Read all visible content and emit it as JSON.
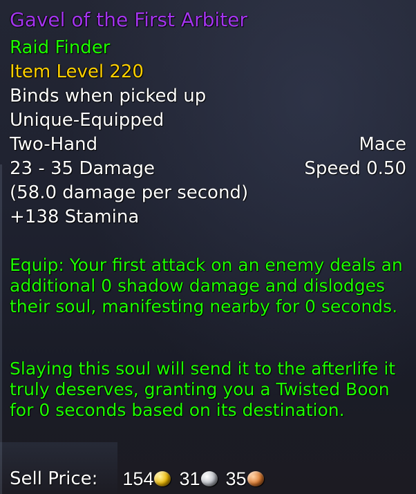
{
  "item": {
    "name": "Gavel of the First Arbiter",
    "difficulty": "Raid Finder",
    "item_level": "Item Level 220",
    "binding": "Binds when picked up",
    "unique": "Unique-Equipped",
    "slot": "Two-Hand",
    "type": "Mace",
    "damage": "23 - 35 Damage",
    "speed": "Speed 0.50",
    "dps": "(58.0 damage per second)",
    "stat": "+138 Stamina",
    "equip_effect": "Equip: Your first attack on an enemy deals an additional 0 shadow damage and dislodges their soul, manifesting nearby for 0 seconds.",
    "effect_detail": "Slaying this soul will send it to the afterlife it truly deserves, granting you a Twisted Boon for 0 seconds based on its destination."
  },
  "sell_price": {
    "label": "Sell Price:",
    "gold": "154",
    "silver": "31",
    "copper": "35"
  },
  "colors": {
    "epic": "#a335ee",
    "green": "#1eff00",
    "item_level": "#ffd100"
  },
  "icons": [
    "gold-coin-icon",
    "silver-coin-icon",
    "copper-coin-icon"
  ]
}
